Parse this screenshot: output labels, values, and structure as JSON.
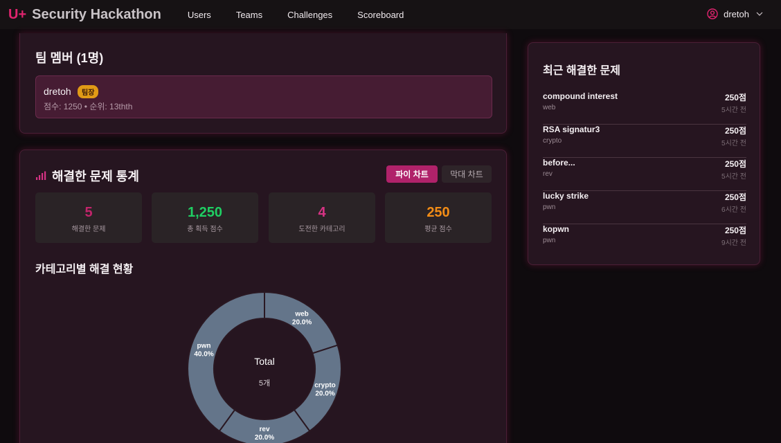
{
  "brand": {
    "mark": "U+",
    "name": "Security Hackathon"
  },
  "nav": {
    "links": [
      "Users",
      "Teams",
      "Challenges",
      "Scoreboard"
    ]
  },
  "user": {
    "name": "dretoh",
    "icon": "user-circle-icon"
  },
  "team": {
    "title": "팀 멤버 (1명)",
    "member": {
      "name": "dretoh",
      "badge": "팀장",
      "meta": "점수: 1250 • 순위: 13thth"
    }
  },
  "stats": {
    "title": "해결한 문제 통계",
    "pie_label": "파이 차트",
    "bar_label": "막대 차트",
    "boxes": [
      {
        "value": "5",
        "label": "해결한 문제",
        "color": "#c2246b"
      },
      {
        "value": "1,250",
        "label": "총 획득 점수",
        "color": "#1fcf63"
      },
      {
        "value": "4",
        "label": "도전한 카테고리",
        "color": "#d63384"
      },
      {
        "value": "250",
        "label": "평균 점수",
        "color": "#f28c16"
      }
    ],
    "category_title": "카테고리별 해결 현황"
  },
  "chart_data": {
    "type": "pie",
    "categories": [
      "web",
      "crypto",
      "rev",
      "pwn"
    ],
    "values": [
      1,
      1,
      1,
      2
    ],
    "percent_labels": [
      "20.0%",
      "20.0%",
      "20.0%",
      "40.0%"
    ],
    "center_title": "Total",
    "center_value": "5개",
    "color": "#64758a"
  },
  "recent": {
    "title": "최근 해결한 문제",
    "items": [
      {
        "name": "compound interest",
        "category": "web",
        "points": "250점",
        "time": "5시간 전"
      },
      {
        "name": "RSA signatur3",
        "category": "crypto",
        "points": "250점",
        "time": "5시간 전"
      },
      {
        "name": "before...",
        "category": "rev",
        "points": "250점",
        "time": "5시간 전"
      },
      {
        "name": "lucky strike",
        "category": "pwn",
        "points": "250점",
        "time": "6시간 전"
      },
      {
        "name": "kopwn",
        "category": "pwn",
        "points": "250점",
        "time": "9시간 전"
      }
    ]
  }
}
